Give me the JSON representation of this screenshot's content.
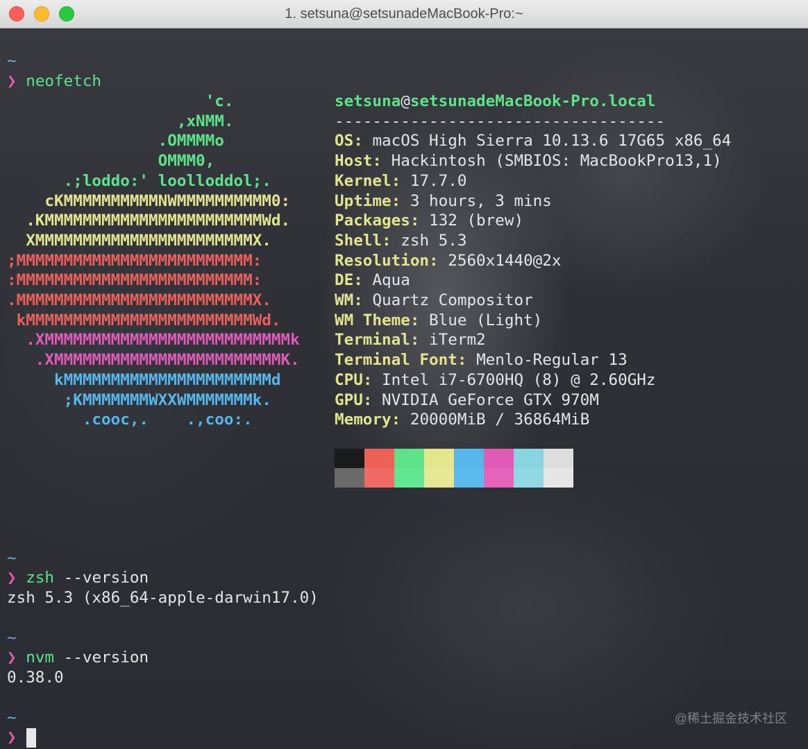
{
  "window": {
    "title": "1. setsuna@setsunadeMacBook-Pro:~",
    "buttons": [
      "close",
      "minimize",
      "maximize"
    ]
  },
  "prompt": {
    "tilde": "~",
    "arrow": "❯"
  },
  "commands": [
    {
      "cmd": "neofetch",
      "args": ""
    },
    {
      "cmd": "zsh",
      "args": " --version",
      "output": "zsh 5.3 (x86_64-apple-darwin17.0)"
    },
    {
      "cmd": "nvm",
      "args": " --version",
      "output": "0.38.0"
    }
  ],
  "neofetch": {
    "logo_lines": [
      "                     'c.",
      "                  ,xNMM.",
      "                .OMMMMo",
      "                OMMM0,",
      "      .;loddo:' loolloddol;.",
      "    cKMMMMMMMMMMNWMMMMMMMMMM0:",
      "  .KMMMMMMMMMMMMMMMMMMMMMMMWd.",
      "  XMMMMMMMMMMMMMMMMMMMMMMMX.",
      ";MMMMMMMMMMMMMMMMMMMMMMMMM:",
      ":MMMMMMMMMMMMMMMMMMMMMMMMM:",
      ".MMMMMMMMMMMMMMMMMMMMMMMMMX.",
      " kMMMMMMMMMMMMMMMMMMMMMMMMWd.",
      "  .XMMMMMMMMMMMMMMMMMMMMMMMMMMk",
      "   .XMMMMMMMMMMMMMMMMMMMMMMMMK.",
      "     kMMMMMMMMMMMMMMMMMMMMMMd",
      "      ;KMMMMMMMWXXWMMMMMMMk.",
      "        .cooc,.    .,coo:."
    ],
    "user": "setsuna",
    "at": "@",
    "host": "setsunadeMacBook-Pro.local",
    "separator": "-----------------------------------",
    "info": [
      {
        "key": "OS",
        "value": "macOS High Sierra 10.13.6 17G65 x86_64"
      },
      {
        "key": "Host",
        "value": "Hackintosh (SMBIOS: MacBookPro13,1)"
      },
      {
        "key": "Kernel",
        "value": "17.7.0"
      },
      {
        "key": "Uptime",
        "value": "3 hours, 3 mins"
      },
      {
        "key": "Packages",
        "value": "132 (brew)"
      },
      {
        "key": "Shell",
        "value": "zsh 5.3"
      },
      {
        "key": "Resolution",
        "value": "2560x1440@2x"
      },
      {
        "key": "DE",
        "value": "Aqua"
      },
      {
        "key": "WM",
        "value": "Quartz Compositor"
      },
      {
        "key": "WM Theme",
        "value": "Blue (Light)"
      },
      {
        "key": "Terminal",
        "value": "iTerm2"
      },
      {
        "key": "Terminal Font",
        "value": "Menlo-Regular 13"
      },
      {
        "key": "CPU",
        "value": "Intel i7-6700HQ (8) @ 2.60GHz"
      },
      {
        "key": "GPU",
        "value": "NVIDIA GeForce GTX 970M"
      },
      {
        "key": "Memory",
        "value": "20000MiB / 36864MiB"
      }
    ],
    "palette_top": [
      "#1a1a1a",
      "#ed6158",
      "#5ee38a",
      "#e4e58d",
      "#56b7ea",
      "#e05ab6",
      "#88d4e0",
      "#dddddd"
    ],
    "palette_bottom": [
      "#6a6a6a",
      "#ef6a64",
      "#62e690",
      "#e7e895",
      "#5cbbee",
      "#e463bb",
      "#8fd8e4",
      "#e6e6e6"
    ]
  },
  "watermark": "@稀土掘金技术社区"
}
